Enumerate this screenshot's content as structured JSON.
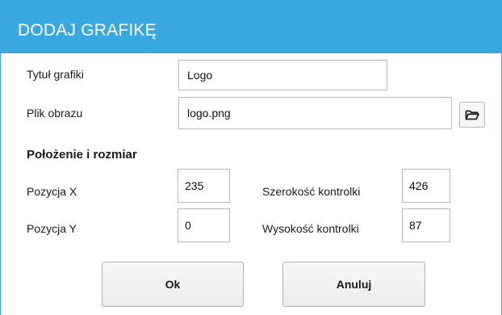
{
  "dialog": {
    "title": "DODAJ GRAFIKĘ"
  },
  "form": {
    "title_label": "Tytuł grafiki",
    "title_value": "Logo",
    "file_label": "Plik obrazu",
    "file_value": "logo.png",
    "browse_icon": "folder-open-icon"
  },
  "position_section": {
    "heading": "Położenie i rozmiar",
    "x_label": "Pozycja X",
    "x_value": "235",
    "y_label": "Pozycja Y",
    "y_value": "0",
    "width_label": "Szerokość kontrolki",
    "width_value": "426",
    "height_label": "Wysokość kontrolki",
    "height_value": "87"
  },
  "buttons": {
    "ok_label": "Ok",
    "cancel_label": "Anuluj"
  },
  "colors": {
    "title_bar": "#3aa8e0",
    "background": "#ffffff"
  }
}
